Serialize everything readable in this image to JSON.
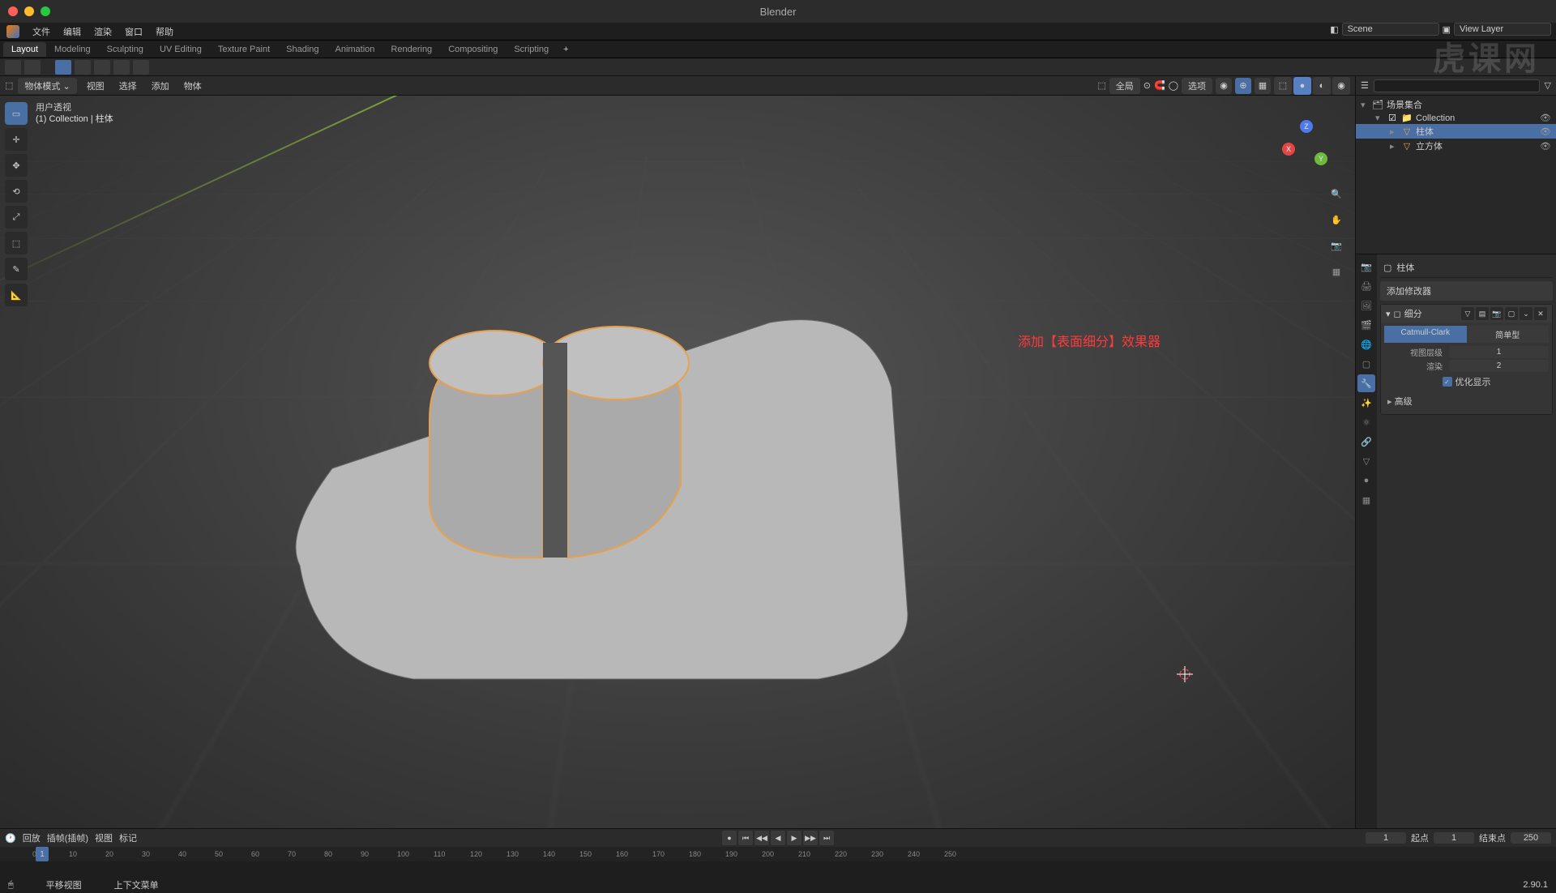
{
  "app": {
    "title": "Blender"
  },
  "menubar": [
    "文件",
    "编辑",
    "渲染",
    "窗口",
    "帮助"
  ],
  "workspaces": {
    "tabs": [
      "Layout",
      "Modeling",
      "Sculpting",
      "UV Editing",
      "Texture Paint",
      "Shading",
      "Animation",
      "Rendering",
      "Compositing",
      "Scripting"
    ],
    "active": "Layout"
  },
  "scene": {
    "scene_label": "Scene",
    "viewlayer_label": "View Layer"
  },
  "viewport": {
    "mode": "物体模式",
    "menus": [
      "视图",
      "选择",
      "添加",
      "物体"
    ],
    "global": "全局",
    "options": "选项",
    "hud_line1": "用户透视",
    "hud_line2": "(1) Collection | 柱体",
    "annotation": "添加【表面细分】效果器"
  },
  "outliner": {
    "root": "场景集合",
    "items": [
      {
        "name": "Collection",
        "type": "collection",
        "depth": 1
      },
      {
        "name": "柱体",
        "type": "mesh",
        "depth": 2,
        "selected": true
      },
      {
        "name": "立方体",
        "type": "mesh",
        "depth": 2
      }
    ]
  },
  "properties": {
    "object_name": "柱体",
    "add_modifier": "添加修改器",
    "modifier": {
      "name": "细分",
      "type_a": "Catmull-Clark",
      "type_b": "简单型",
      "viewport_label": "视图层级",
      "viewport_value": "1",
      "render_label": "渲染",
      "render_value": "2",
      "optimal": "优化显示",
      "advanced": "高级"
    }
  },
  "timeline": {
    "menus": [
      "回放",
      "插帧(插帧)",
      "视图",
      "标记"
    ],
    "current": "1",
    "start_label": "起点",
    "start": "1",
    "end_label": "结束点",
    "end": "250",
    "ticks": [
      0,
      10,
      20,
      30,
      40,
      50,
      60,
      70,
      80,
      90,
      100,
      110,
      120,
      130,
      140,
      150,
      160,
      170,
      180,
      190,
      200,
      210,
      220,
      230,
      240,
      250
    ]
  },
  "statusbar": {
    "hint1": "平移视图",
    "hint2": "上下文菜单",
    "version": "2.90.1"
  },
  "watermark": "虎课网"
}
